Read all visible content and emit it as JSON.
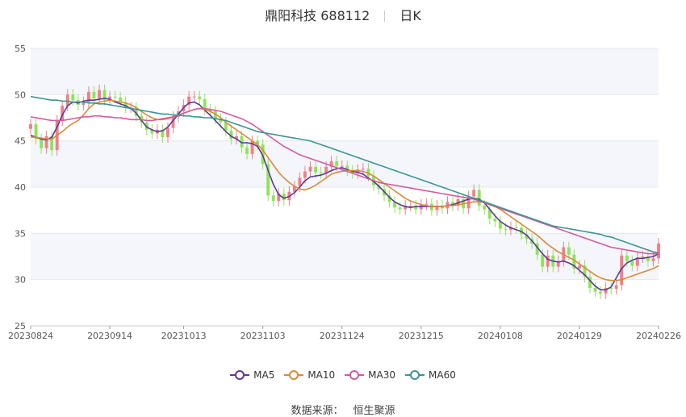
{
  "header": {
    "title": "鼎阳科技 688112",
    "period": "日K"
  },
  "source": {
    "label": "数据来源：",
    "provider": "恒生聚源"
  },
  "colors": {
    "up": "#f07f8a",
    "down": "#8fe35a",
    "MA5": "#5b3a93",
    "MA10": "#d98a3a",
    "MA30": "#d45aa0",
    "MA60": "#3a9593"
  },
  "chart_data": {
    "type": "candlestick",
    "title": "鼎阳科技 688112",
    "ylim": [
      25,
      55
    ],
    "y_ticks": [
      25,
      30,
      35,
      40,
      45,
      50,
      55
    ],
    "x_ticks": [
      "20230824",
      "20230914",
      "20231013",
      "20231103",
      "20231124",
      "20231215",
      "20240108",
      "20240129",
      "20240226"
    ],
    "x_tick_index": [
      0,
      15,
      29,
      44,
      59,
      74,
      89,
      104,
      119
    ],
    "n_days": 120,
    "candle_closes": [
      46.8,
      45.2,
      44.2,
      45.5,
      44.0,
      47.2,
      48.8,
      50.0,
      49.4,
      48.9,
      49.2,
      50.3,
      49.6,
      50.5,
      49.4,
      49.8,
      49.7,
      49.2,
      48.6,
      48.6,
      47.7,
      47.0,
      46.2,
      45.8,
      46.2,
      45.4,
      46.4,
      47.6,
      48.2,
      48.9,
      49.8,
      49.8,
      49.5,
      48.4,
      48.2,
      47.4,
      47.0,
      46.1,
      45.2,
      45.5,
      44.3,
      43.6,
      45.0,
      44.6,
      42.5,
      39.1,
      38.5,
      39.3,
      38.6,
      39.5,
      40.1,
      41.0,
      41.7,
      42.2,
      41.6,
      41.5,
      42.2,
      42.8,
      42.3,
      42.3,
      41.8,
      41.5,
      41.9,
      42.0,
      41.2,
      40.2,
      39.8,
      39.1,
      38.4,
      37.8,
      37.6,
      38.0,
      38.0,
      37.6,
      38.1,
      38.2,
      37.5,
      38.0,
      37.7,
      38.4,
      38.0,
      38.7,
      37.7,
      39.0,
      39.7,
      38.0,
      37.6,
      36.6,
      36.3,
      35.5,
      35.4,
      35.7,
      35.6,
      34.9,
      34.4,
      33.9,
      32.7,
      31.4,
      32.6,
      31.4,
      32.0,
      33.5,
      32.7,
      31.2,
      31.5,
      30.3,
      29.1,
      28.7,
      28.5,
      29.1,
      29.0,
      29.4,
      32.6,
      32.0,
      31.5,
      32.4,
      32.5,
      32.0,
      32.3,
      33.9
    ],
    "candle_opens": [
      46.3,
      46.8,
      45.2,
      44.2,
      45.5,
      44.0,
      47.2,
      48.8,
      50.0,
      49.4,
      48.9,
      49.2,
      50.3,
      49.6,
      50.5,
      49.4,
      49.8,
      49.7,
      49.2,
      48.6,
      48.6,
      47.7,
      47.0,
      46.2,
      45.8,
      46.2,
      45.4,
      46.4,
      47.6,
      48.2,
      48.9,
      49.8,
      49.8,
      49.5,
      48.4,
      48.2,
      47.4,
      47.0,
      46.1,
      45.2,
      45.5,
      44.3,
      43.6,
      45.0,
      44.6,
      42.5,
      39.1,
      38.5,
      39.3,
      38.6,
      39.5,
      40.1,
      41.0,
      41.7,
      42.2,
      41.6,
      41.5,
      42.2,
      42.8,
      42.3,
      42.3,
      41.8,
      41.5,
      41.9,
      42.0,
      41.2,
      40.2,
      39.8,
      39.1,
      38.4,
      37.8,
      37.6,
      38.0,
      38.0,
      37.6,
      38.1,
      38.2,
      37.5,
      38.0,
      37.7,
      38.4,
      38.0,
      38.7,
      37.7,
      39.0,
      39.7,
      38.0,
      37.6,
      36.6,
      36.3,
      35.5,
      35.4,
      35.7,
      35.6,
      34.9,
      34.4,
      33.9,
      32.7,
      31.4,
      32.6,
      31.4,
      32.0,
      33.5,
      32.7,
      31.2,
      31.5,
      30.3,
      29.1,
      28.7,
      28.5,
      29.1,
      29.0,
      29.4,
      32.6,
      32.0,
      31.5,
      32.4,
      32.5,
      32.0,
      32.3
    ],
    "series": [
      {
        "name": "MA5",
        "values": [
          45.6,
          45.4,
          45.2,
          45.1,
          45.4,
          46.5,
          47.8,
          48.8,
          49.2,
          49.1,
          49.3,
          49.4,
          49.4,
          49.5,
          49.6,
          49.5,
          49.2,
          49.0,
          48.8,
          48.5,
          48.0,
          47.2,
          46.5,
          46.2,
          46.0,
          46.1,
          46.5,
          47.2,
          47.9,
          48.6,
          49.1,
          49.2,
          48.9,
          48.3,
          47.8,
          47.2,
          46.6,
          46.0,
          45.5,
          45.2,
          44.8,
          44.8,
          44.7,
          44.4,
          43.4,
          41.8,
          40.3,
          39.2,
          38.8,
          39.0,
          39.4,
          40.0,
          40.7,
          41.1,
          41.2,
          41.3,
          41.5,
          41.8,
          42.0,
          42.1,
          41.9,
          41.7,
          41.6,
          41.4,
          41.0,
          40.6,
          40.1,
          39.5,
          38.9,
          38.4,
          38.1,
          37.9,
          37.8,
          37.9,
          37.9,
          37.9,
          37.9,
          37.9,
          37.9,
          38.0,
          38.1,
          38.3,
          38.5,
          38.7,
          38.8,
          38.7,
          38.3,
          37.6,
          36.9,
          36.3,
          35.9,
          35.6,
          35.4,
          35.2,
          34.8,
          34.2,
          33.5,
          32.8,
          32.2,
          32.0,
          31.9,
          32.0,
          31.8,
          31.5,
          31.0,
          30.5,
          29.9,
          29.3,
          28.9,
          28.9,
          29.2,
          30.2,
          31.2,
          31.8,
          32.1,
          32.3,
          32.3,
          32.4,
          32.5,
          32.8
        ]
      },
      {
        "name": "MA10",
        "values": [
          45.4,
          45.4,
          45.3,
          45.2,
          45.2,
          45.6,
          46.0,
          46.5,
          46.9,
          47.2,
          47.8,
          48.5,
          49.0,
          49.2,
          49.3,
          49.4,
          49.3,
          49.2,
          49.1,
          48.9,
          48.6,
          48.2,
          47.8,
          47.5,
          47.3,
          47.3,
          47.4,
          47.6,
          47.8,
          48.0,
          48.2,
          48.4,
          48.5,
          48.4,
          48.2,
          47.9,
          47.5,
          47.0,
          46.6,
          46.2,
          45.8,
          45.4,
          45.0,
          44.6,
          44.0,
          43.2,
          42.4,
          41.6,
          41.0,
          40.5,
          40.1,
          39.8,
          39.7,
          39.9,
          40.2,
          40.6,
          41.0,
          41.4,
          41.6,
          41.7,
          41.8,
          41.8,
          41.8,
          41.7,
          41.5,
          41.2,
          40.8,
          40.4,
          40.0,
          39.6,
          39.2,
          38.8,
          38.5,
          38.3,
          38.1,
          38.0,
          37.9,
          37.9,
          37.9,
          38.0,
          38.0,
          38.1,
          38.2,
          38.3,
          38.4,
          38.4,
          38.4,
          38.2,
          37.9,
          37.6,
          37.2,
          36.8,
          36.4,
          36.0,
          35.6,
          35.2,
          34.8,
          34.3,
          33.8,
          33.4,
          33.0,
          32.7,
          32.4,
          32.1,
          31.7,
          31.3,
          30.9,
          30.5,
          30.2,
          30.0,
          29.9,
          29.9,
          30.0,
          30.2,
          30.4,
          30.6,
          30.8,
          31.0,
          31.2,
          31.5
        ]
      },
      {
        "name": "MA30",
        "values": [
          47.6,
          47.5,
          47.4,
          47.3,
          47.2,
          47.2,
          47.2,
          47.3,
          47.4,
          47.5,
          47.6,
          47.6,
          47.7,
          47.7,
          47.6,
          47.6,
          47.5,
          47.5,
          47.4,
          47.3,
          47.3,
          47.3,
          47.2,
          47.2,
          47.3,
          47.4,
          47.5,
          47.6,
          47.8,
          48.0,
          48.2,
          48.4,
          48.5,
          48.5,
          48.4,
          48.3,
          48.2,
          48.0,
          47.8,
          47.6,
          47.4,
          47.1,
          46.8,
          46.4,
          46.0,
          45.6,
          45.2,
          44.8,
          44.4,
          44.1,
          43.8,
          43.5,
          43.3,
          43.1,
          42.9,
          42.7,
          42.5,
          42.3,
          42.1,
          41.9,
          41.7,
          41.5,
          41.3,
          41.1,
          40.9,
          40.7,
          40.5,
          40.4,
          40.3,
          40.2,
          40.1,
          40.0,
          39.9,
          39.8,
          39.7,
          39.6,
          39.5,
          39.4,
          39.3,
          39.2,
          39.1,
          39.0,
          38.9,
          38.8,
          38.7,
          38.5,
          38.3,
          38.1,
          37.9,
          37.7,
          37.5,
          37.3,
          37.1,
          36.9,
          36.7,
          36.5,
          36.3,
          36.1,
          35.9,
          35.7,
          35.5,
          35.3,
          35.1,
          34.9,
          34.7,
          34.5,
          34.3,
          34.1,
          33.9,
          33.7,
          33.5,
          33.4,
          33.3,
          33.2,
          33.1,
          33.0,
          32.9,
          32.8,
          32.8,
          32.8
        ]
      },
      {
        "name": "MA60",
        "values": [
          49.8,
          49.7,
          49.6,
          49.5,
          49.4,
          49.4,
          49.3,
          49.3,
          49.2,
          49.2,
          49.2,
          49.1,
          49.1,
          49.0,
          49.0,
          48.9,
          48.8,
          48.7,
          48.6,
          48.5,
          48.4,
          48.3,
          48.2,
          48.1,
          48.0,
          47.9,
          47.9,
          47.8,
          47.8,
          47.7,
          47.7,
          47.6,
          47.6,
          47.5,
          47.5,
          47.4,
          47.3,
          47.2,
          47.0,
          46.8,
          46.6,
          46.4,
          46.2,
          46.0,
          45.9,
          45.8,
          45.7,
          45.6,
          45.5,
          45.4,
          45.3,
          45.2,
          45.1,
          45.0,
          44.8,
          44.6,
          44.4,
          44.2,
          44.0,
          43.8,
          43.6,
          43.4,
          43.2,
          43.0,
          42.8,
          42.6,
          42.4,
          42.2,
          42.0,
          41.8,
          41.6,
          41.4,
          41.2,
          41.0,
          40.8,
          40.6,
          40.4,
          40.2,
          40.0,
          39.8,
          39.6,
          39.4,
          39.2,
          39.0,
          38.8,
          38.6,
          38.4,
          38.2,
          38.0,
          37.8,
          37.6,
          37.4,
          37.2,
          37.0,
          36.8,
          36.6,
          36.4,
          36.2,
          36.0,
          35.8,
          35.7,
          35.6,
          35.5,
          35.4,
          35.3,
          35.2,
          35.1,
          35.0,
          34.9,
          34.7,
          34.6,
          34.4,
          34.2,
          34.0,
          33.8,
          33.6,
          33.4,
          33.2,
          33.0,
          32.9
        ]
      }
    ],
    "legend_position": "bottom",
    "grid": true
  }
}
